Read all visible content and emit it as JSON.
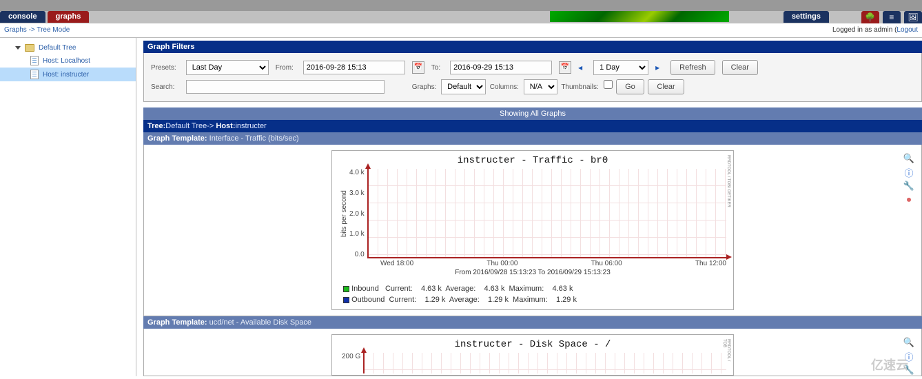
{
  "tabs": {
    "console": "console",
    "graphs": "graphs",
    "settings": "settings"
  },
  "breadcrumb": {
    "link": "Graphs",
    "rest": " -> Tree Mode"
  },
  "login": {
    "prefix": "Logged in as ",
    "user": "admin",
    "lparen": " (",
    "logout": "Logout"
  },
  "tree": {
    "root": "Default Tree",
    "items": [
      {
        "label": "Host: Localhost"
      },
      {
        "label": "Host: instructer"
      }
    ]
  },
  "filters": {
    "title": "Graph Filters",
    "presets_label": "Presets:",
    "preset": "Last Day",
    "from_label": "From:",
    "from": "2016-09-28 15:13",
    "to_label": "To:",
    "to": "2016-09-29 15:13",
    "span": "1 Day",
    "refresh": "Refresh",
    "clear": "Clear",
    "search_label": "Search:",
    "graphs_label": "Graphs:",
    "graphs": "Default",
    "columns_label": "Columns:",
    "columns": "N/A",
    "thumbnails_label": "Thumbnails:",
    "go": "Go",
    "clear2": "Clear"
  },
  "barShowing": "Showing All Graphs",
  "navy": {
    "tree_lbl": "Tree:",
    "tree_val": "Default Tree",
    "sep": "-> ",
    "host_lbl": "Host:",
    "host_val": "instructer"
  },
  "tpl1": {
    "lbl": "Graph Template: ",
    "val": "Interface - Traffic (bits/sec)"
  },
  "tpl2": {
    "lbl": "Graph Template: ",
    "val": "ucd/net - Available Disk Space"
  },
  "graph1": {
    "title": "instructer - Traffic - br0",
    "ylabel": "bits per second",
    "range": "From 2016/09/28 15:13:23 To 2016/09/29 15:13:23",
    "side": "RRDTOOL / TOBI OETIKER",
    "legend": {
      "row1": "Inbound   Current:    4.63 k  Average:    4.63 k  Maximum:    4.63 k",
      "row2": "Outbound  Current:    1.29 k  Average:    1.29 k  Maximum:    1.29 k"
    }
  },
  "graph2": {
    "title": "instructer - Disk Space - /",
    "side": "RRDTOOL / TOB"
  },
  "chart_data": [
    {
      "type": "line",
      "title": "instructer - Traffic - br0",
      "ylabel": "bits per second",
      "yticks": [
        "4.0 k",
        "3.0 k",
        "2.0 k",
        "1.0 k",
        "0.0"
      ],
      "ylim": [
        0,
        4500
      ],
      "xticks": [
        "Wed 18:00",
        "Thu 00:00",
        "Thu 06:00",
        "Thu 12:00"
      ],
      "x_range": "From 2016/09/28 15:13:23 To 2016/09/29 15:13:23",
      "series": [
        {
          "name": "Inbound",
          "color": "#1dbb1d",
          "current": 4630,
          "average": 4630,
          "maximum": 4630
        },
        {
          "name": "Outbound",
          "color": "#1030aa",
          "current": 1290,
          "average": 1290,
          "maximum": 1290
        }
      ]
    },
    {
      "type": "area",
      "title": "instructer - Disk Space - /",
      "yticks": [
        "200 G"
      ],
      "series": []
    }
  ],
  "watermark": {
    "big": "亿速云",
    "small": ""
  }
}
